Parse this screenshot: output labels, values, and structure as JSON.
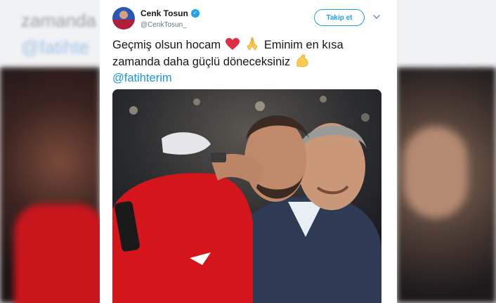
{
  "backdrop": {
    "line1": "zamanda",
    "line2": "@fatihte"
  },
  "tweet": {
    "author_name": "Cenk Tosun",
    "author_handle": "@CenkTosun_",
    "follow_label": "Takip et",
    "text_line1_a": "Geçmiş olsun hocam",
    "text_line1_b": "Eminim en kısa",
    "text_line2": "zamanda daha güçlü döneceksiniz",
    "mention": "@fatihterim",
    "emojis": [
      "red-heart-icon",
      "folded-hands-icon",
      "flexed-biceps-icon"
    ]
  },
  "colors": {
    "accent": "#1da1f2",
    "mention": "#1b95e0",
    "text": "#14171a",
    "muted": "#657786",
    "jersey_red": "#d4161c"
  }
}
